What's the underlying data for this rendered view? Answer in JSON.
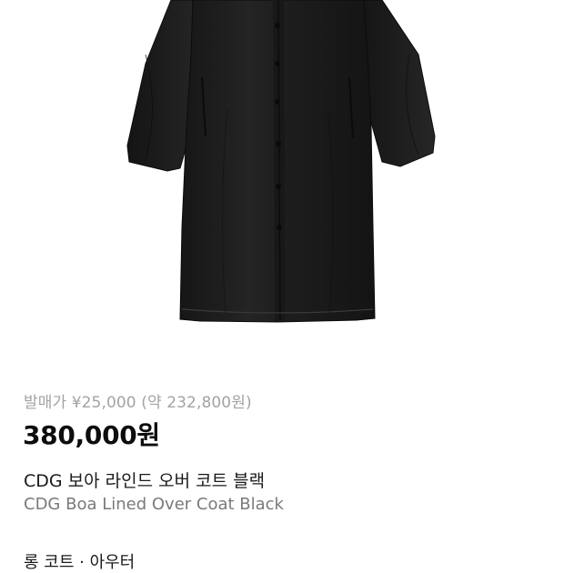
{
  "product": {
    "image_icon": "coat-image",
    "release_price": "발매가 ¥25,000 (약 232,800원)",
    "price": "380,000원",
    "title_ko": "CDG 보아 라인드 오버 코트 블랙",
    "title_en": "CDG Boa Lined Over Coat Black",
    "category": "롱 코트 · 아우터"
  },
  "colors": {
    "coat": "#1c1c1c",
    "coat_shadow": "#0f0f0f",
    "coat_highlight": "#2f2f2f",
    "muted_text": "#a3a3a3",
    "secondary_text": "#7a7a7a"
  }
}
